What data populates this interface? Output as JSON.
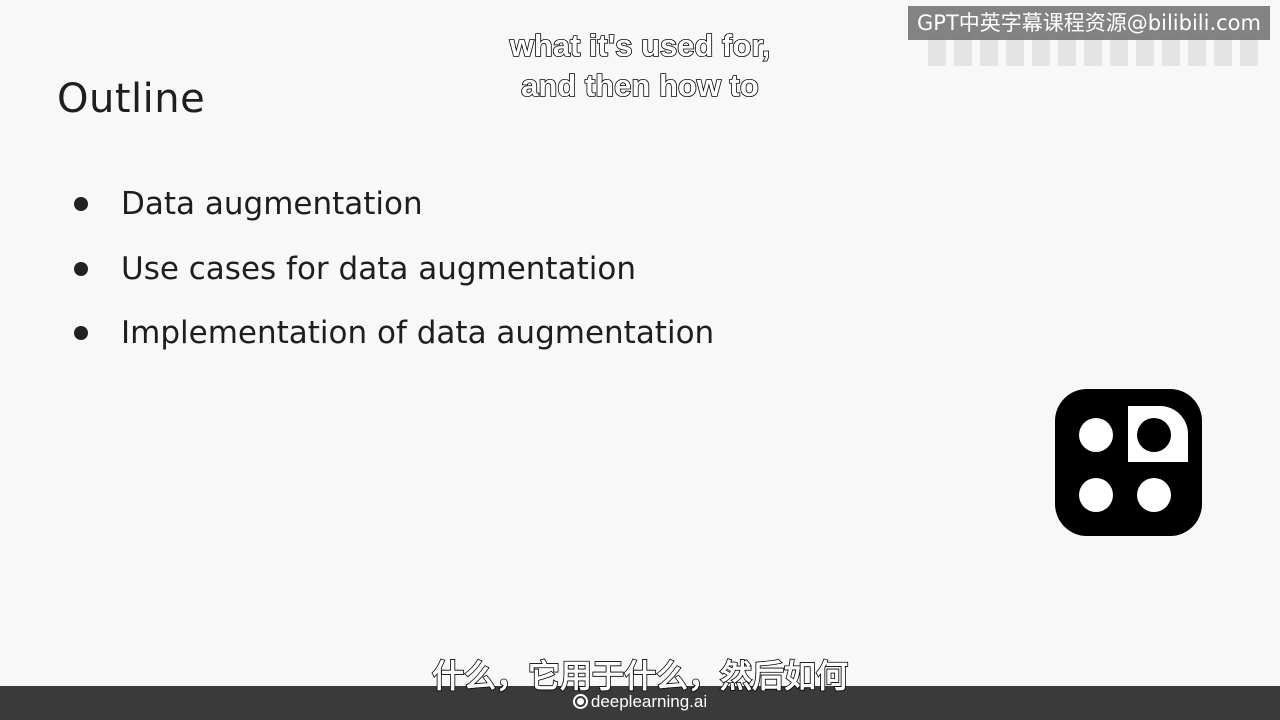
{
  "slide": {
    "title": "Outline",
    "bullets": [
      "Data augmentation",
      "Use cases for data augmentation",
      "Implementation of data augmentation"
    ]
  },
  "watermark": {
    "text": "GPT中英字幕课程资源@bilibili.com"
  },
  "subtitles": {
    "english_line_1": "what it's used for,",
    "english_line_2": "and then how to",
    "chinese": "什么，它用于什么，然后如何"
  },
  "footer": {
    "brand": "deeplearning.ai",
    "brand_icon": "deeplearning-logo-icon"
  },
  "logo": {
    "icon": "dots-tile-icon"
  },
  "colors": {
    "slide_bg": "#f8f8f8",
    "text": "#1e1e1e",
    "footer_bg": "#3a3a3a",
    "logo_bg": "#000000"
  }
}
